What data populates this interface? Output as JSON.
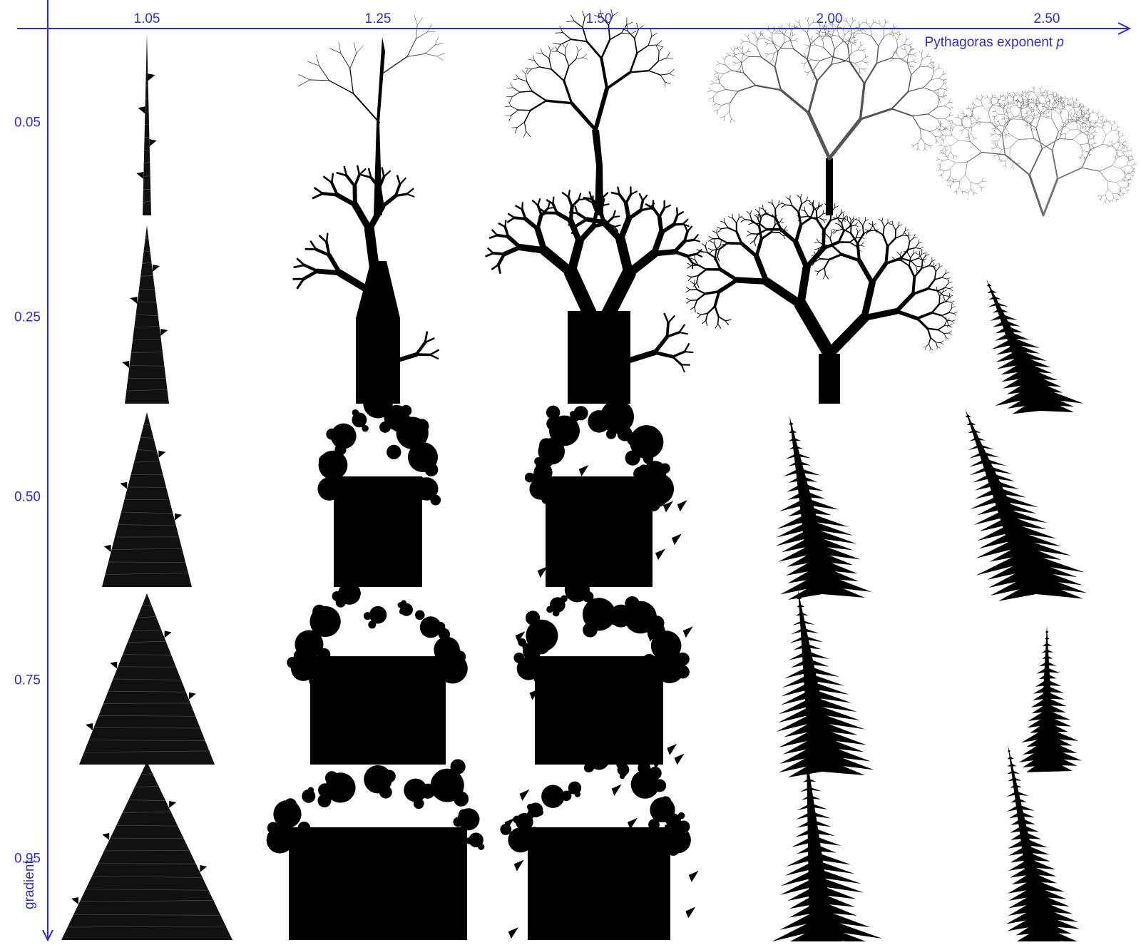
{
  "axis_color": "#2f2fc8",
  "x_axis": {
    "title": "Pythagoras exponent",
    "title_var": "p",
    "values": [
      "1.05",
      "1.25",
      "1.50",
      "2.00",
      "2.50"
    ]
  },
  "y_axis": {
    "title": "gradient",
    "values": [
      "0.05",
      "0.25",
      "0.50",
      "0.75",
      "0.95"
    ]
  },
  "grid": {
    "description_rows": 5,
    "description_cols": 5,
    "cells": [
      [
        {
          "p": "1.05",
          "g": "0.05",
          "shape": "thin-spike"
        },
        {
          "p": "1.25",
          "g": "0.05",
          "shape": "sparse-tree"
        },
        {
          "p": "1.50",
          "g": "0.05",
          "shape": "branching-tree"
        },
        {
          "p": "2.00",
          "g": "0.05",
          "shape": "lacy-tree"
        },
        {
          "p": "2.50",
          "g": "0.05",
          "shape": "dense-lacy-tree"
        }
      ],
      [
        {
          "p": "1.05",
          "g": "0.25",
          "shape": "narrow-cone"
        },
        {
          "p": "1.25",
          "g": "0.25",
          "shape": "stubby-tree"
        },
        {
          "p": "1.50",
          "g": "0.25",
          "shape": "thick-tree"
        },
        {
          "p": "2.00",
          "g": "0.25",
          "shape": "bushy-tree"
        },
        {
          "p": "2.50",
          "g": "0.25",
          "shape": "leaning-fern"
        }
      ],
      [
        {
          "p": "1.05",
          "g": "0.50",
          "shape": "cone"
        },
        {
          "p": "1.25",
          "g": "0.50",
          "shape": "wide-tree"
        },
        {
          "p": "1.50",
          "g": "0.50",
          "shape": "blob-tree"
        },
        {
          "p": "2.00",
          "g": "0.50",
          "shape": "spiky-tree"
        },
        {
          "p": "2.50",
          "g": "0.50",
          "shape": "fern"
        }
      ],
      [
        {
          "p": "1.05",
          "g": "0.75",
          "shape": "wide-cone"
        },
        {
          "p": "1.25",
          "g": "0.75",
          "shape": "crown-block"
        },
        {
          "p": "1.50",
          "g": "0.75",
          "shape": "jagged-block"
        },
        {
          "p": "2.00",
          "g": "0.75",
          "shape": "spiky-fern"
        },
        {
          "p": "2.50",
          "g": "0.75",
          "shape": "thin-fern"
        }
      ],
      [
        {
          "p": "1.05",
          "g": "0.95",
          "shape": "pyramid"
        },
        {
          "p": "1.25",
          "g": "0.95",
          "shape": "wide-crown"
        },
        {
          "p": "1.50",
          "g": "0.95",
          "shape": "jagged-tower"
        },
        {
          "p": "2.00",
          "g": "0.95",
          "shape": "spike-tower"
        },
        {
          "p": "2.50",
          "g": "0.95",
          "shape": "needle-fern"
        }
      ]
    ]
  }
}
